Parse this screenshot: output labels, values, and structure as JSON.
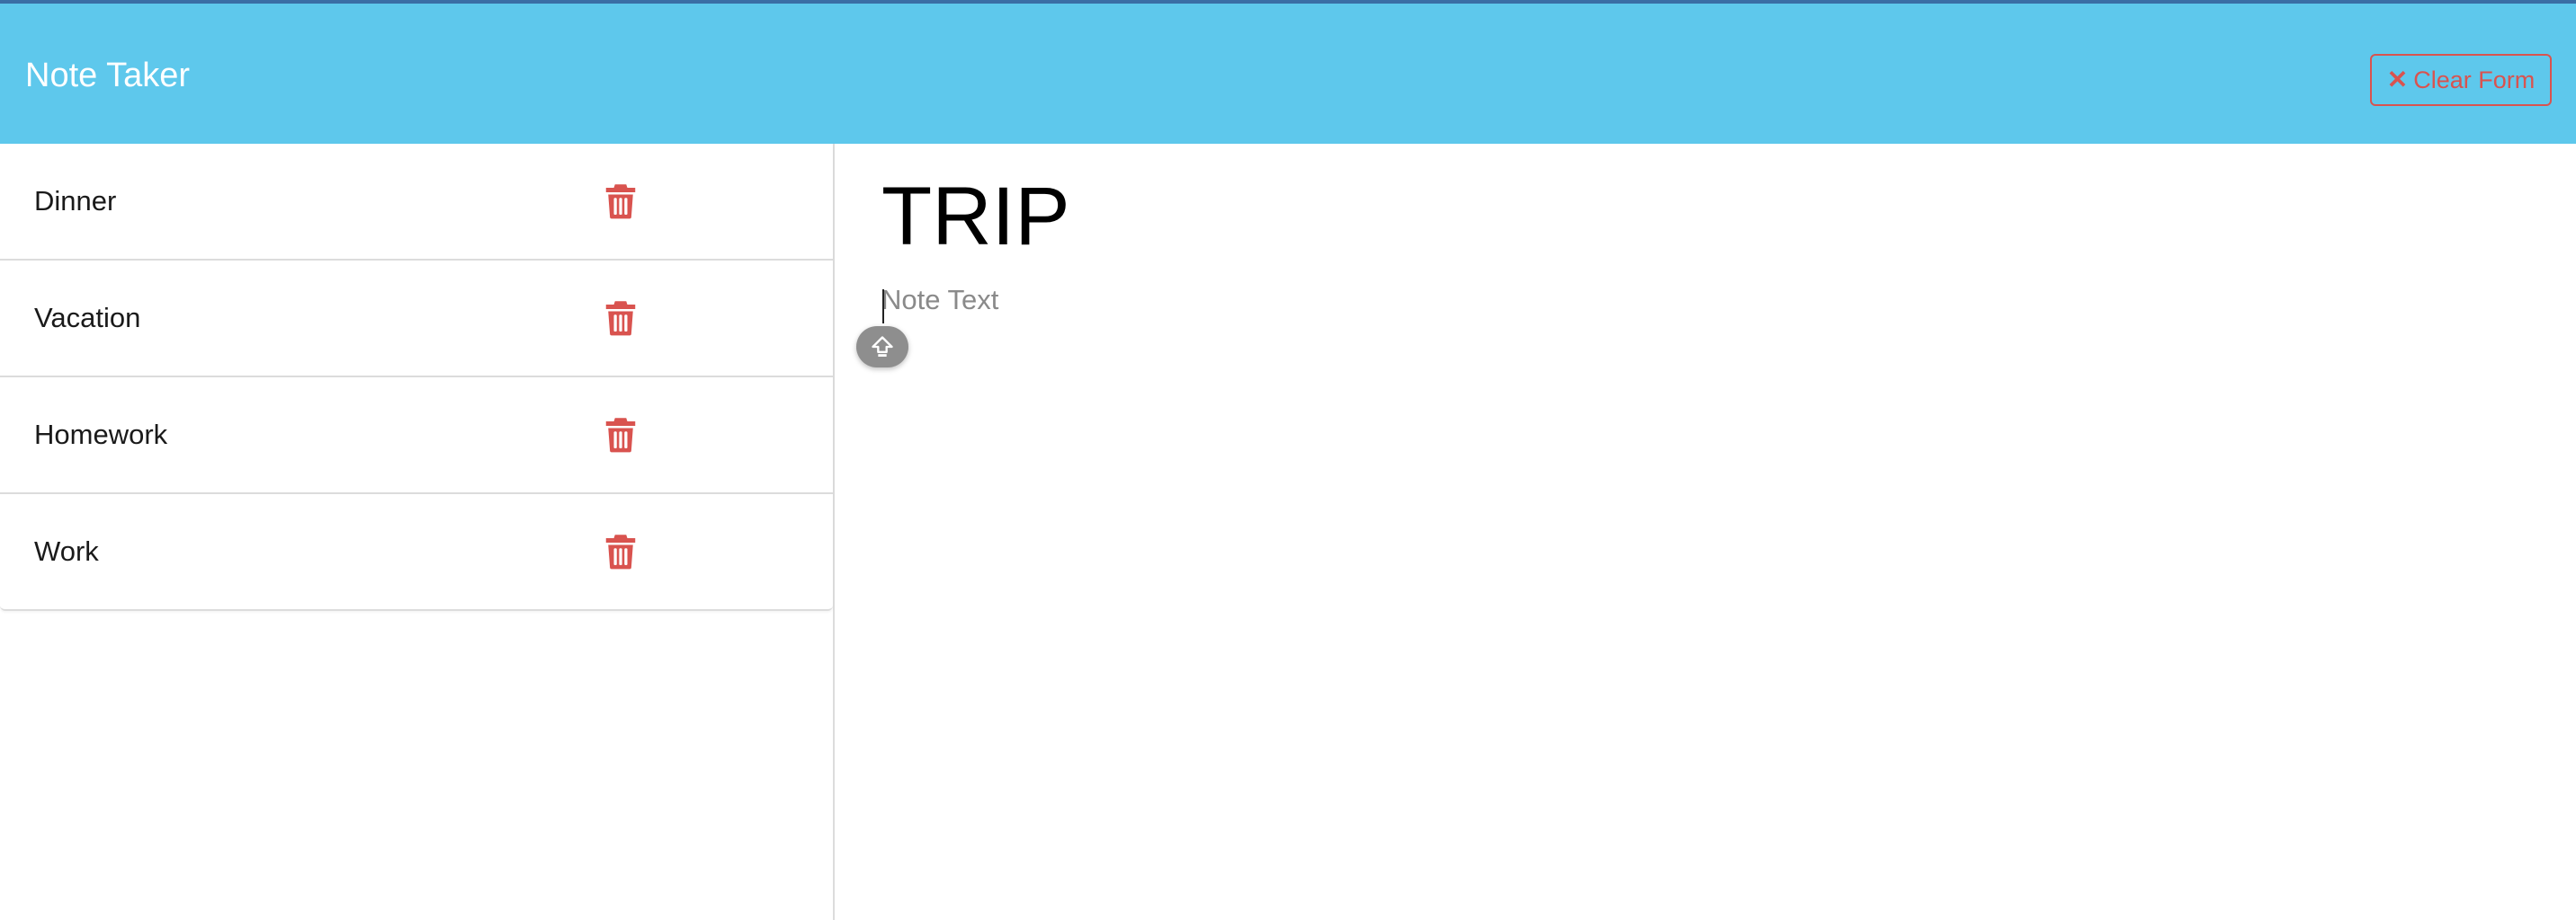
{
  "navbar": {
    "brand": "Note Taker",
    "clear_button_label": "Clear Form",
    "clear_button_icon": "x-icon",
    "background_color": "#5ec8ec"
  },
  "notes": {
    "items": [
      {
        "title": "Dinner",
        "icon": "trash-icon"
      },
      {
        "title": "Vacation",
        "icon": "trash-icon"
      },
      {
        "title": "Homework",
        "icon": "trash-icon"
      },
      {
        "title": "Work",
        "icon": "trash-icon"
      }
    ],
    "delete_icon_color": "#d9534f"
  },
  "editor": {
    "title_value": "TRIP",
    "text_placeholder": "Note Text",
    "text_value": "",
    "caps_lock_icon": "caps-lock-icon"
  }
}
